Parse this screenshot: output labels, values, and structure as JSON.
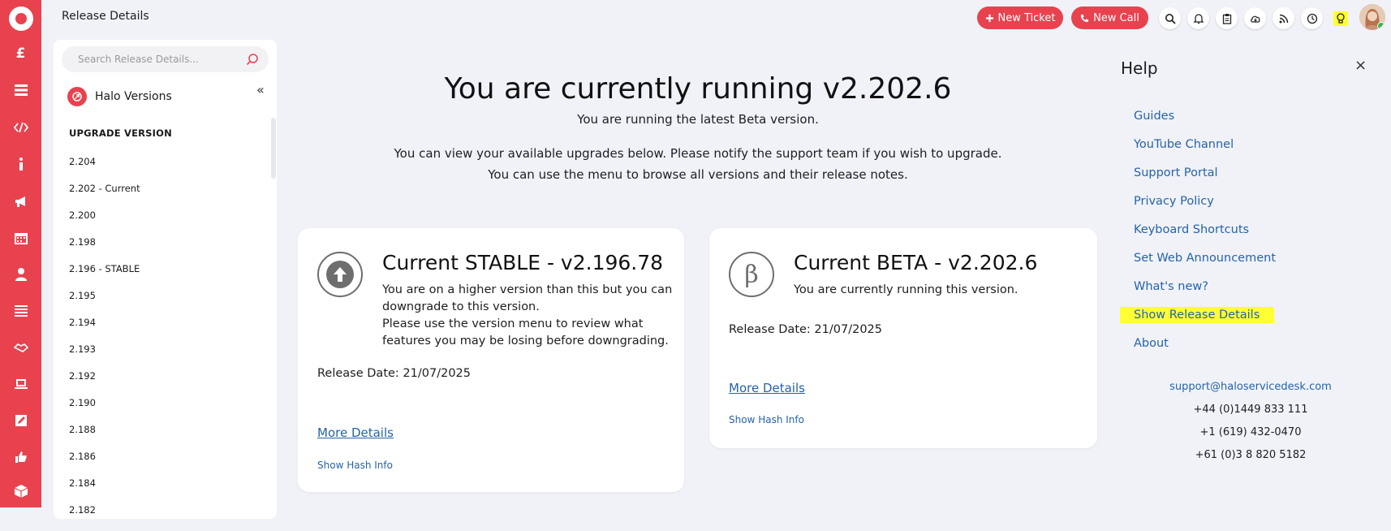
{
  "topbar": {
    "title": "Release Details",
    "new_ticket": "New Ticket",
    "new_call": "New Call",
    "icons": [
      "search-icon",
      "bell-icon",
      "clipboard-icon",
      "cloud-download-icon",
      "rss-icon",
      "clock-icon",
      "lightbulb-icon"
    ]
  },
  "rail": {
    "icons": [
      "logo",
      "pound-icon",
      "list-icon",
      "code-icon",
      "info-icon",
      "megaphone-icon",
      "calendar-icon",
      "user-icon",
      "menu-icon",
      "handshake-icon",
      "laptop-icon",
      "edit-icon",
      "thumbs-up-icon",
      "box-icon"
    ],
    "pound_symbol": "£"
  },
  "sidebar": {
    "search_placeholder": "Search Release Details...",
    "header": "Halo Versions",
    "section": "UPGRADE VERSION",
    "versions": [
      "2.204",
      "2.202 - Current",
      "2.200",
      "2.198",
      "2.196 - STABLE",
      "2.195",
      "2.194",
      "2.193",
      "2.192",
      "2.190",
      "2.188",
      "2.186",
      "2.184",
      "2.182"
    ]
  },
  "main": {
    "title": "You are currently running v2.202.6",
    "status": "You are running the latest Beta version.",
    "info1": "You can view your available upgrades below. Please notify the support team if you wish to upgrade.",
    "info2": "You can use the menu to browse all versions and their release notes."
  },
  "stable_card": {
    "title": "Current STABLE - v2.196.78",
    "desc1": "You are on a higher version than this but you can",
    "desc2": "downgrade to this version.",
    "desc3": "Please use the version menu to review what",
    "desc4": "features you may be losing before downgrading.",
    "release_date": "Release Date: 21/07/2025",
    "more": "More Details",
    "hash": "Show Hash Info"
  },
  "beta_card": {
    "title": "Current BETA - v2.202.6",
    "symbol": "β",
    "desc": "You are currently running this version.",
    "release_date": "Release Date: 21/07/2025",
    "more": "More Details",
    "hash": "Show Hash Info"
  },
  "help": {
    "title": "Help",
    "close": "×",
    "links": [
      "Guides",
      "YouTube Channel",
      "Support Portal",
      "Privacy Policy",
      "Keyboard Shortcuts",
      "Set Web Announcement",
      "What's new?",
      "Show Release Details",
      "About"
    ],
    "email": "support@haloservicedesk.com",
    "phone_uk": "+44 (0)1449 833 111",
    "phone_us": "+1 (619) 432-0470",
    "phone_au": "+61 (0)3 8 820 5182"
  },
  "colors": {
    "brand": "#e8424f",
    "link": "#2563a8",
    "highlight": "#ffff33"
  }
}
